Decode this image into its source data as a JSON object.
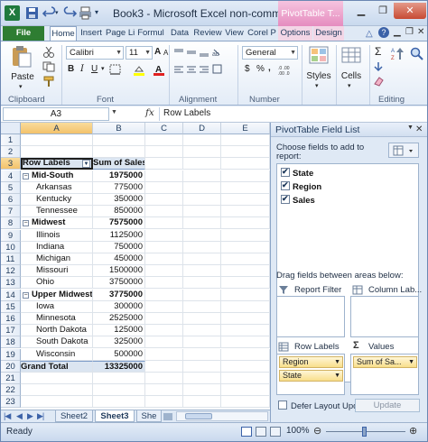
{
  "window": {
    "title": "Book3 - Microsoft Excel non-comme...",
    "context_tab": "PivotTable T...",
    "app_icon": "X"
  },
  "ribbon_tabs": [
    "File",
    "Home",
    "Insert",
    "Page Li",
    "Formul",
    "Data",
    "Review",
    "View",
    "Corel P",
    "Options",
    "Design"
  ],
  "ribbon": {
    "clipboard": {
      "label": "Clipboard",
      "paste": "Paste"
    },
    "font": {
      "label": "Font",
      "name": "Calibri",
      "size": "11",
      "bold": "B",
      "italic": "I",
      "underline": "U",
      "grow": "A",
      "shrink": "A"
    },
    "alignment": {
      "label": "Alignment"
    },
    "number": {
      "label": "Number",
      "format": "General",
      "currency": "$",
      "percent": "%",
      "comma": ","
    },
    "styles": {
      "label": "Styles"
    },
    "cells": {
      "label": "Cells"
    },
    "editing": {
      "label": "Editing",
      "sum": "Σ"
    }
  },
  "formula_bar": {
    "name_box": "A3",
    "fx": "fx",
    "content": "Row Labels"
  },
  "grid": {
    "columns": [
      "A",
      "B",
      "C",
      "D",
      "E"
    ],
    "selected_column": "A",
    "selected_row": 3,
    "rows": [
      {
        "n": "1",
        "a": "",
        "b": "",
        "kind": "empty"
      },
      {
        "n": "2",
        "a": "",
        "b": "",
        "kind": "empty"
      },
      {
        "n": "3",
        "a": "Row Labels",
        "b": "Sum of Sales",
        "kind": "header"
      },
      {
        "n": "4",
        "a": "Mid-South",
        "b": "1975000",
        "kind": "group"
      },
      {
        "n": "5",
        "a": "Arkansas",
        "b": "775000",
        "kind": "item"
      },
      {
        "n": "6",
        "a": "Kentucky",
        "b": "350000",
        "kind": "item"
      },
      {
        "n": "7",
        "a": "Tennessee",
        "b": "850000",
        "kind": "item"
      },
      {
        "n": "8",
        "a": "Midwest",
        "b": "7575000",
        "kind": "group"
      },
      {
        "n": "9",
        "a": "Illinois",
        "b": "1125000",
        "kind": "item"
      },
      {
        "n": "10",
        "a": "Indiana",
        "b": "750000",
        "kind": "item"
      },
      {
        "n": "11",
        "a": "Michigan",
        "b": "450000",
        "kind": "item"
      },
      {
        "n": "12",
        "a": "Missouri",
        "b": "1500000",
        "kind": "item"
      },
      {
        "n": "13",
        "a": "Ohio",
        "b": "3750000",
        "kind": "item"
      },
      {
        "n": "14",
        "a": "Upper Midwest",
        "b": "3775000",
        "kind": "group"
      },
      {
        "n": "15",
        "a": "Iowa",
        "b": "300000",
        "kind": "item"
      },
      {
        "n": "16",
        "a": "Minnesota",
        "b": "2525000",
        "kind": "item"
      },
      {
        "n": "17",
        "a": "North Dakota",
        "b": "125000",
        "kind": "item"
      },
      {
        "n": "18",
        "a": "South Dakota",
        "b": "325000",
        "kind": "item"
      },
      {
        "n": "19",
        "a": "Wisconsin",
        "b": "500000",
        "kind": "item"
      },
      {
        "n": "20",
        "a": "Grand Total",
        "b": "13325000",
        "kind": "total"
      },
      {
        "n": "21",
        "a": "",
        "b": "",
        "kind": "empty"
      },
      {
        "n": "22",
        "a": "",
        "b": "",
        "kind": "empty"
      },
      {
        "n": "23",
        "a": "",
        "b": "",
        "kind": "empty"
      }
    ]
  },
  "sheet_tabs": {
    "tabs": [
      "Sheet2",
      "Sheet3",
      "She"
    ],
    "active": "Sheet3"
  },
  "status": {
    "text": "Ready",
    "zoom": "100%"
  },
  "pivot_pane": {
    "title": "PivotTable Field List",
    "choose_label_1": "Choose fields to add to",
    "choose_label_2": "report:",
    "fields": [
      {
        "name": "State",
        "checked": true
      },
      {
        "name": "Region",
        "checked": true
      },
      {
        "name": "Sales",
        "checked": true
      }
    ],
    "drag_label": "Drag fields between areas below:",
    "report_filter": "Report Filter",
    "column_labels": "Column Lab...",
    "row_labels": "Row Labels",
    "values": "Values",
    "row_chips": [
      "Region",
      "State"
    ],
    "value_chips": [
      "Sum of Sa..."
    ],
    "defer_label": "Defer Layout Upd...",
    "update_button": "Update"
  },
  "colors": {
    "file_tab": "#2e7d32",
    "pivot_context": "#e58cbf",
    "pivot_header": "#dbe5f1",
    "selection": "#f3c26b"
  }
}
